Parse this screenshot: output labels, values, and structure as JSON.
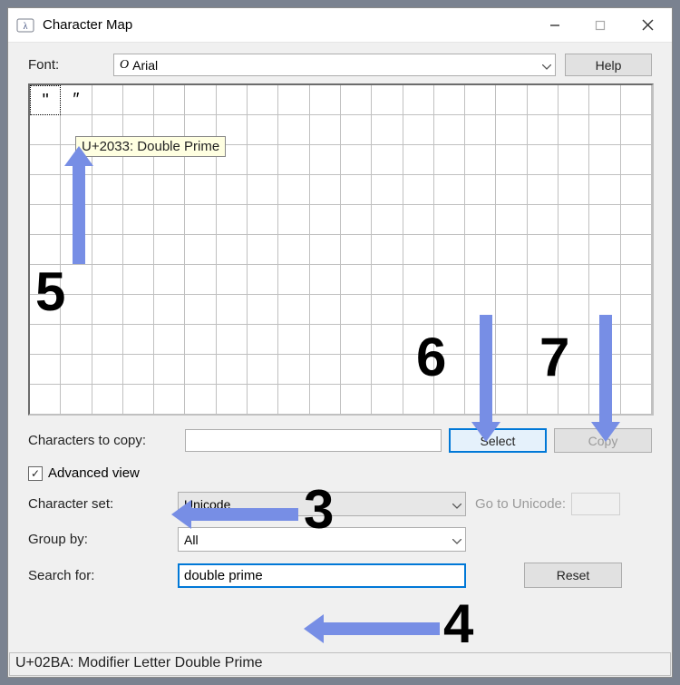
{
  "window": {
    "title": "Character Map"
  },
  "font": {
    "label": "Font:",
    "selected": "Arial",
    "help_label": "Help"
  },
  "grid": {
    "chars": [
      "\"",
      "″"
    ],
    "tooltip": "U+2033: Double Prime"
  },
  "copy": {
    "label": "Characters to copy:",
    "value": "",
    "select_label": "Select",
    "copy_label": "Copy"
  },
  "advanced": {
    "checkbox_label": "Advanced view",
    "checked": true,
    "charset_label": "Character set:",
    "charset_value": "Unicode",
    "groupby_label": "Group by:",
    "groupby_value": "All",
    "goto_label": "Go to Unicode:",
    "search_label": "Search for:",
    "search_value": "double prime",
    "reset_label": "Reset"
  },
  "status": "U+02BA: Modifier Letter Double Prime",
  "annotations": {
    "n3": "3",
    "n4": "4",
    "n5": "5",
    "n6": "6",
    "n7": "7"
  },
  "colors": {
    "arrow": "#778ee5",
    "accent": "#0078d7"
  }
}
